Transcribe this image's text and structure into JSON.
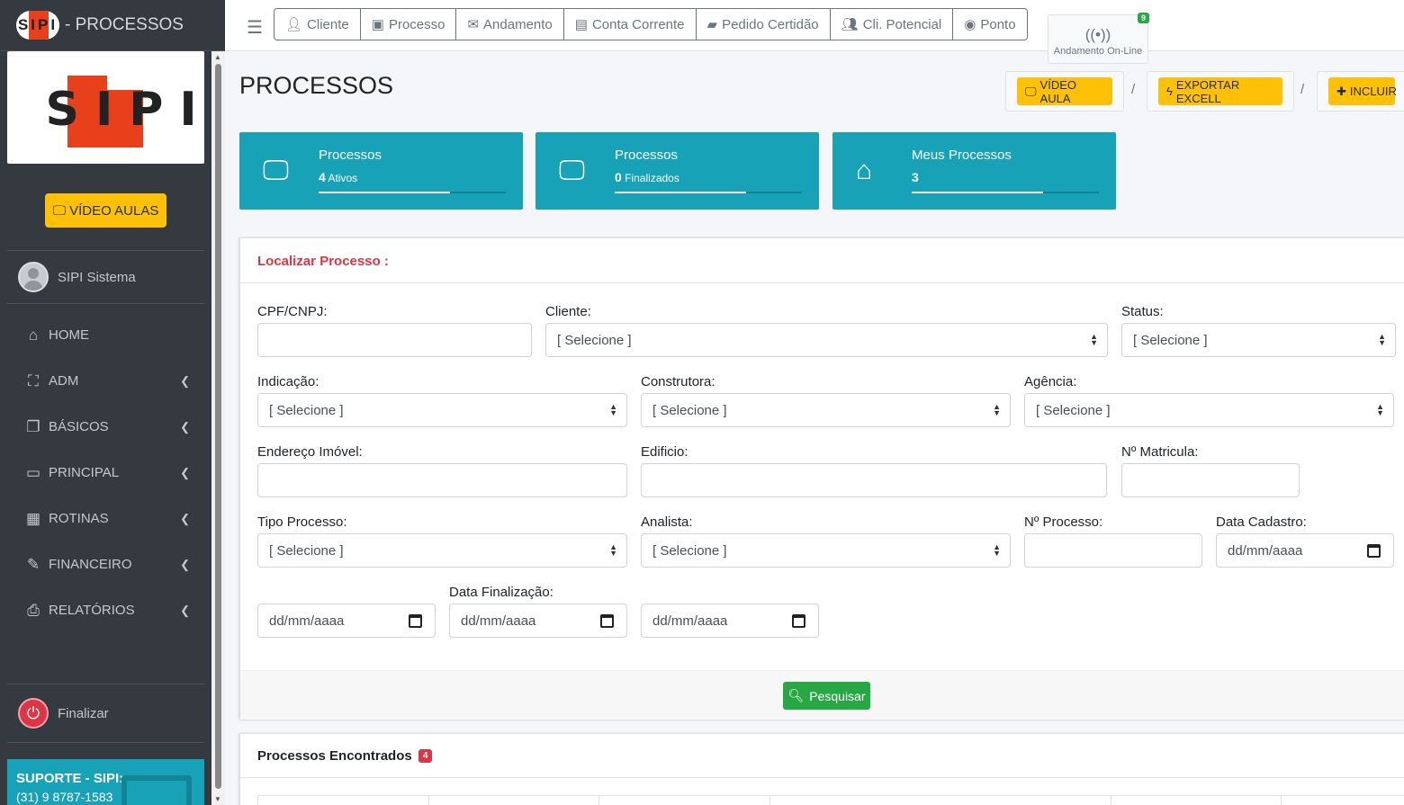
{
  "brand": {
    "logo_text": "SIPI",
    "title": "- PROCESSOS"
  },
  "sidebar": {
    "video_aulas": "VÍDEO AULAS",
    "user_name": "SIPI Sistema",
    "items": [
      {
        "label": "HOME",
        "icon": "home-icon"
      },
      {
        "label": "ADM",
        "icon": "sitemap-icon"
      },
      {
        "label": "BÁSICOS",
        "icon": "copy-icon"
      },
      {
        "label": "PRINCIPAL",
        "icon": "desktop-icon"
      },
      {
        "label": "ROTINAS",
        "icon": "table-icon"
      },
      {
        "label": "FINANCEIRO",
        "icon": "edit-icon"
      },
      {
        "label": "RELATÓRIOS",
        "icon": "print-icon"
      }
    ],
    "finalizar": "Finalizar",
    "suporte_title": "SUPORTE - SIPI:",
    "suporte_phone": "(31) 9 8787-1583"
  },
  "topnav": {
    "buttons": [
      {
        "label": "Cliente",
        "icon": "user-icon"
      },
      {
        "label": "Processo",
        "icon": "archive-icon"
      },
      {
        "label": "Andamento",
        "icon": "envelope-icon"
      },
      {
        "label": "Conta Corrente",
        "icon": "calculator-icon"
      },
      {
        "label": "Pedido Certidão",
        "icon": "folder-icon"
      },
      {
        "label": "Cli. Potencial",
        "icon": "users-icon"
      },
      {
        "label": "Ponto",
        "icon": "eye-icon"
      }
    ],
    "andamento_label": "Andamento On-Line",
    "andamento_badge": "9"
  },
  "page": {
    "title": "PROCESSOS",
    "video_aula": "VÍDEO AULA",
    "exportar": "EXPORTAR EXCELL",
    "incluir": "INCLUIR",
    "separator": "/"
  },
  "info_boxes": [
    {
      "title": "Processos",
      "number": "4",
      "suffix": "Ativos",
      "progress": 0.7
    },
    {
      "title": "Processos",
      "number": "0",
      "suffix": "Finalizados",
      "progress": 0.7
    },
    {
      "title": "Meus Processos",
      "number": "3",
      "suffix": "",
      "progress": 0.7
    }
  ],
  "search": {
    "header": "Localizar Processo :",
    "labels": {
      "cpf": "CPF/CNPJ:",
      "cliente": "Cliente:",
      "status": "Status:",
      "indicacao": "Indicação:",
      "construtora": "Construtora:",
      "agencia": "Agência:",
      "endereco": "Endereço Imóvel:",
      "edificio": "Edificio:",
      "matricula": "Nº Matricula:",
      "tipo": "Tipo Processo:",
      "analista": "Analista:",
      "nprocesso": "Nº Processo:",
      "data_cadastro": "Data Cadastro:",
      "data_finalizacao": "Data Finalização:"
    },
    "select_placeholder": "[ Selecione ]",
    "date_placeholder": "dd/mm/aaaa",
    "button": "Pesquisar"
  },
  "results": {
    "header": "Processos Encontrados",
    "count": "4"
  }
}
